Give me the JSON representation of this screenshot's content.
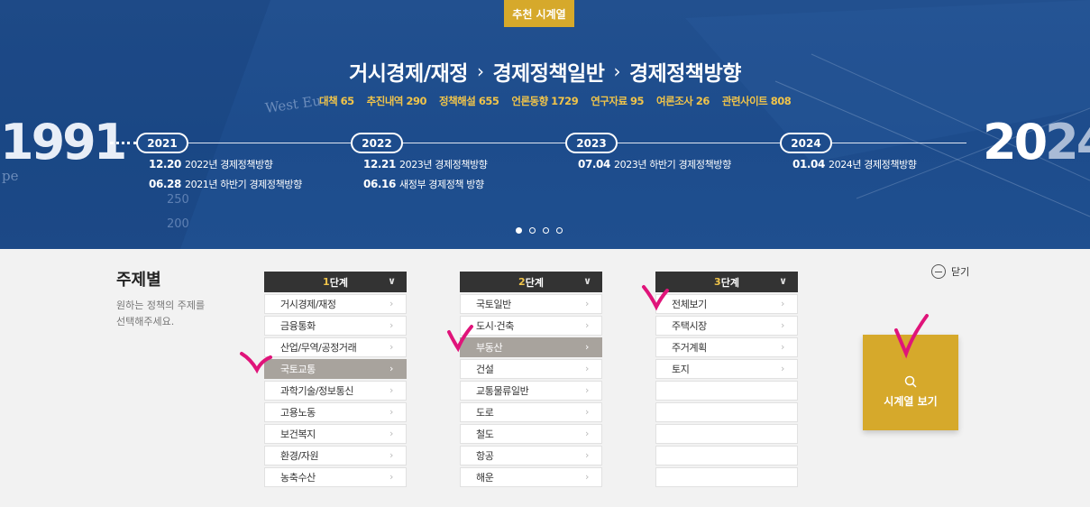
{
  "hero": {
    "recommend_label": "추천 시계열",
    "breadcrumb": [
      "거시경제/재정",
      "경제정책일반",
      "경제정책방향"
    ],
    "breadcrumb_sep": "›",
    "stats": [
      "대책 65",
      "추진내역 290",
      "정책해설 655",
      "언론동향 1729",
      "연구자료 95",
      "여론조사 26",
      "관련사이트 808"
    ],
    "year_start": "1991",
    "year_end_a": "20",
    "year_end_b": "24",
    "timeline": [
      {
        "year": "2021",
        "events": [
          {
            "date": "12.20",
            "text": "2022년 경제정책방향"
          },
          {
            "date": "06.28",
            "text": "2021년 하반기 경제정책방향"
          }
        ]
      },
      {
        "year": "2022",
        "events": [
          {
            "date": "12.21",
            "text": "2023년 경제정책방향"
          },
          {
            "date": "06.16",
            "text": "새정부 경제정책 방향"
          }
        ]
      },
      {
        "year": "2023",
        "events": [
          {
            "date": "07.04",
            "text": "2023년 하반기 경제정책방향"
          }
        ]
      },
      {
        "year": "2024",
        "events": [
          {
            "date": "01.04",
            "text": "2024년 경제정책방향"
          }
        ]
      }
    ],
    "deco_text": [
      "West Eu",
      "pe",
      "250",
      "200"
    ]
  },
  "selector": {
    "title": "주제별",
    "description": "원하는 정책의 주제를 선택해주세요.",
    "close_label": "닫기",
    "view_label": "시계열 보기",
    "columns": [
      {
        "num": "1",
        "suffix": "단계",
        "items": [
          "거시경제/재정",
          "금융통화",
          "산업/무역/공정거래",
          "국토교통",
          "과학기술/정보통신",
          "고용노동",
          "보건복지",
          "환경/자원",
          "농축수산"
        ],
        "selected": 3
      },
      {
        "num": "2",
        "suffix": "단계",
        "items": [
          "국토일반",
          "도시·건축",
          "부동산",
          "건설",
          "교통물류일반",
          "도로",
          "철도",
          "항공",
          "해운"
        ],
        "selected": 2
      },
      {
        "num": "3",
        "suffix": "단계",
        "items": [
          "전체보기",
          "주택시장",
          "주거계획",
          "토지",
          "",
          "",
          "",
          "",
          ""
        ],
        "selected": -1
      }
    ]
  },
  "colors": {
    "accent": "#d6a92b",
    "hero_bg": "#1d4c8c",
    "selected_bg": "#a8a39d",
    "annotation": "#e0147a"
  },
  "carousel": {
    "count": 4,
    "active": 0
  }
}
